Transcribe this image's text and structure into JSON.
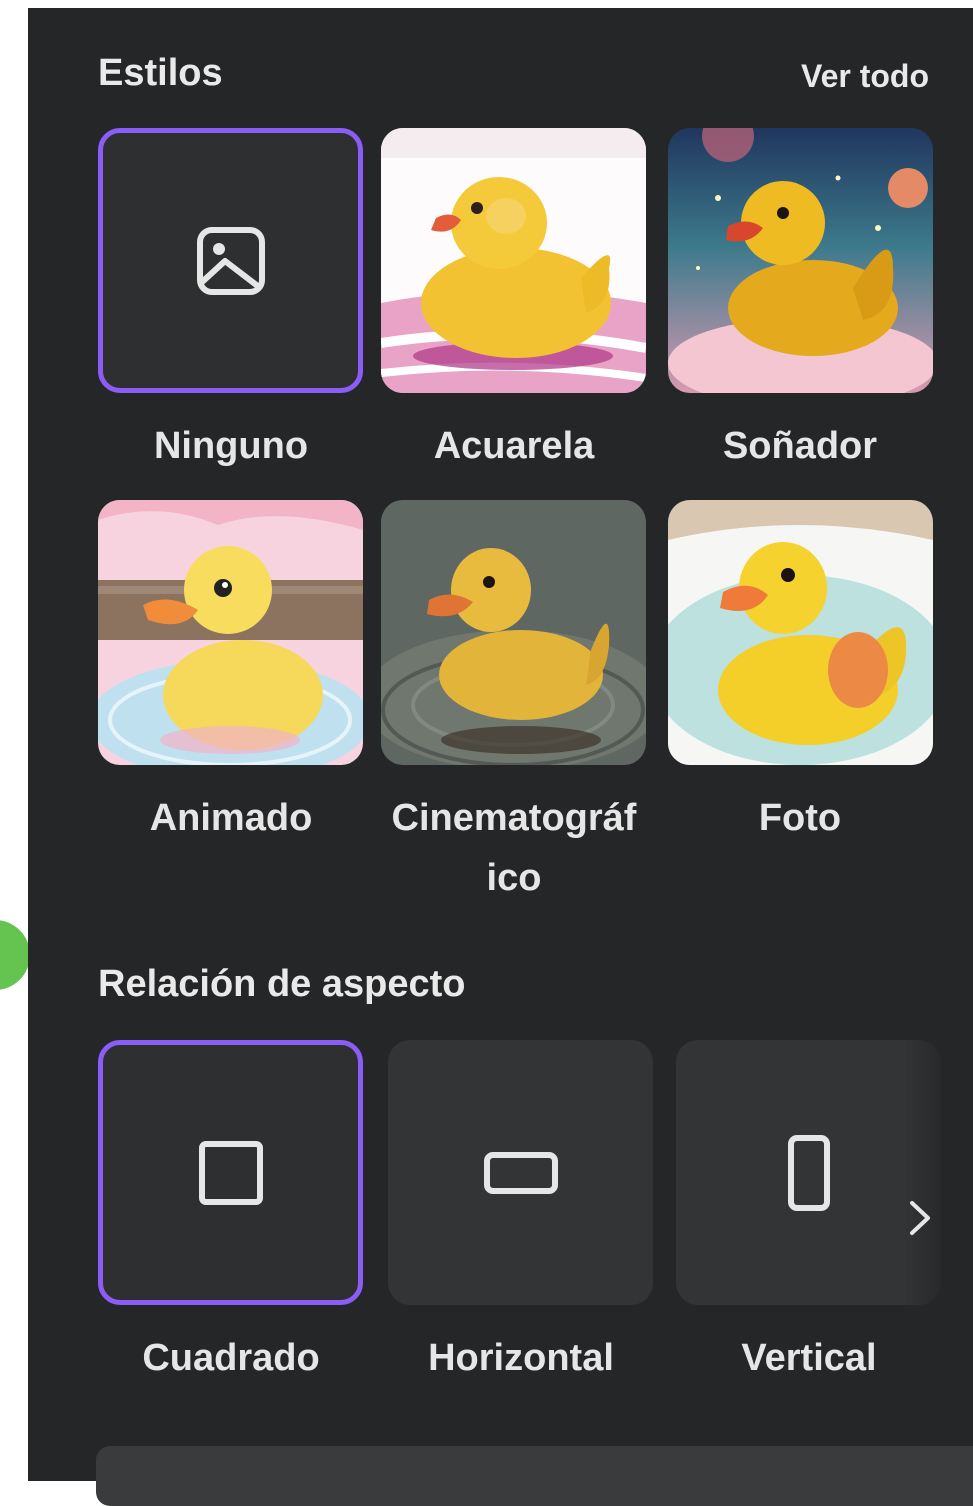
{
  "styles": {
    "title": "Estilos",
    "see_all": "Ver todo",
    "items": [
      {
        "label": "Ninguno",
        "selected": true
      },
      {
        "label": "Acuarela"
      },
      {
        "label": "Soñador"
      },
      {
        "label": "Animado"
      },
      {
        "label": "Cinematográf\nico"
      },
      {
        "label": "Foto"
      }
    ]
  },
  "aspect": {
    "title": "Relación de aspecto",
    "items": [
      {
        "label": "Cuadrado",
        "icon": "square-icon",
        "selected": true
      },
      {
        "label": "Horizontal",
        "icon": "landscape-rectangle-icon"
      },
      {
        "label": "Vertical",
        "icon": "portrait-rectangle-icon"
      }
    ]
  },
  "colors": {
    "panel_bg": "#252627",
    "selected_border": "#8b5cf6",
    "text": "#e9e9ea"
  }
}
